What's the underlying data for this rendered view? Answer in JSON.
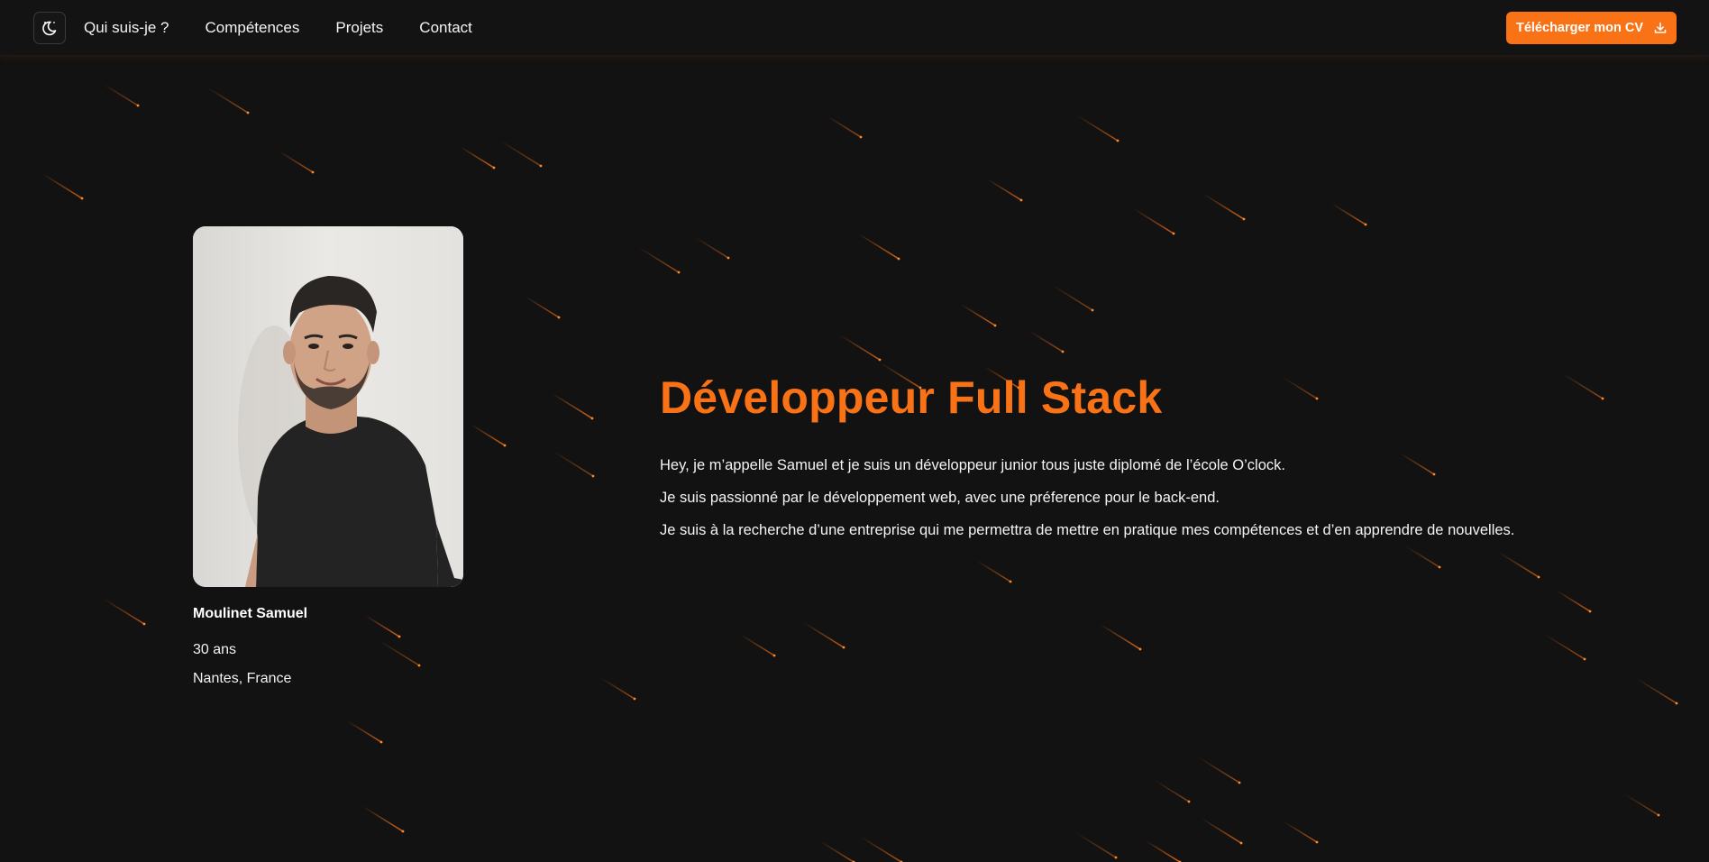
{
  "nav": {
    "logo_icon": "moon-stars-icon",
    "links": [
      "Qui suis-je ?",
      "Compétences",
      "Projets",
      "Contact"
    ],
    "cv_button": {
      "label": "Télécharger mon CV",
      "icon": "download-icon"
    }
  },
  "profile": {
    "photo_alt": "Portrait of a smiling man in a black t-shirt",
    "name": "Moulinet Samuel",
    "age": "30 ans",
    "location": "Nantes, France"
  },
  "hero": {
    "title": "Développeur Full Stack",
    "paragraphs": [
      "Hey, je m’appelle Samuel et je suis un développeur junior tous juste diplomé de l’école O’clock.",
      "Je suis passionné par le développement web, avec une préference pour le back-end.",
      "Je suis à la recherche d’une entreprise qui me permettra de mettre en pratique mes compétences et d’en apprendre de nouvelles."
    ]
  },
  "colors": {
    "accent": "#f97316",
    "background": "#121212",
    "text": "#f4f4f4"
  }
}
